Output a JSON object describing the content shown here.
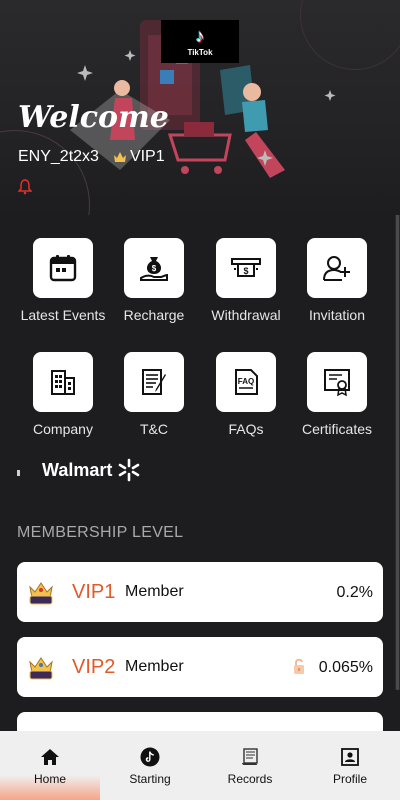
{
  "header": {
    "logo_icon": "tiktok-note-icon",
    "logo_text": "TikTok",
    "welcome": "Welcome",
    "username": "ENY_2t2x3",
    "vip_level": "VIP1",
    "bell_icon": "bell-icon"
  },
  "grid": {
    "row1": [
      {
        "label": "Latest Events",
        "icon": "calendar-icon"
      },
      {
        "label": "Recharge",
        "icon": "money-bag-icon"
      },
      {
        "label": "Withdrawal",
        "icon": "cash-icon"
      },
      {
        "label": "Invitation",
        "icon": "add-user-icon"
      }
    ],
    "row2": [
      {
        "label": "Company",
        "icon": "building-icon"
      },
      {
        "label": "T&C",
        "icon": "document-icon"
      },
      {
        "label": "FAQs",
        "icon": "faq-icon"
      },
      {
        "label": "Certificates",
        "icon": "certificate-icon"
      }
    ]
  },
  "partner": {
    "name": "Walmart",
    "icon": "walmart-spark-icon"
  },
  "membership": {
    "title": "MEMBERSHIP LEVEL",
    "levels": [
      {
        "name": "VIP1",
        "label": "Member",
        "rate": "0.2%",
        "locked": false
      },
      {
        "name": "VIP2",
        "label": "Member",
        "rate": "0.065%",
        "locked": true
      }
    ]
  },
  "nav": {
    "items": [
      {
        "label": "Home",
        "icon": "home-icon",
        "active": true
      },
      {
        "label": "Starting",
        "icon": "tiktok-icon",
        "active": false
      },
      {
        "label": "Records",
        "icon": "scroll-icon",
        "active": false
      },
      {
        "label": "Profile",
        "icon": "profile-card-icon",
        "active": false
      }
    ]
  },
  "colors": {
    "background": "#1d1d1f",
    "vip_text": "#e25a27",
    "nav_active": "#f6a588",
    "nav_background": "#efefef"
  }
}
